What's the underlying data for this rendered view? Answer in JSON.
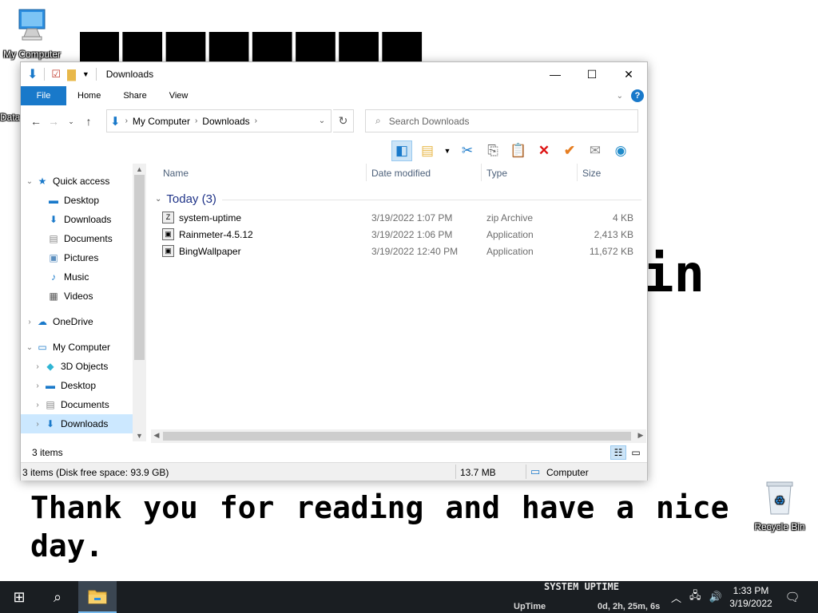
{
  "desktop": {
    "wallpaper_text_mid": "in",
    "wallpaper_text_bottom": "Thank you for reading and have a nice day.",
    "icons": {
      "my_computer": "My Computer",
      "data": "Data",
      "recycle_bin": "Recycle Bin"
    }
  },
  "window": {
    "title": "Downloads",
    "controls": {
      "minimize": "—",
      "maximize": "☐",
      "close": "✕"
    },
    "ribbon": {
      "tabs": [
        "File",
        "Home",
        "Share",
        "View"
      ],
      "help": "?"
    },
    "address": {
      "crumbs": [
        "My Computer",
        "Downloads"
      ],
      "search_placeholder": "Search Downloads"
    },
    "nav_pane": {
      "items": [
        {
          "label": "Quick access",
          "icon": "star-icon"
        },
        {
          "label": "Desktop",
          "icon": "desktop-icon"
        },
        {
          "label": "Downloads",
          "icon": "download-icon"
        },
        {
          "label": "Documents",
          "icon": "document-icon"
        },
        {
          "label": "Pictures",
          "icon": "picture-icon"
        },
        {
          "label": "Music",
          "icon": "music-icon"
        },
        {
          "label": "Videos",
          "icon": "video-icon"
        },
        {
          "label": "OneDrive",
          "icon": "cloud-icon"
        },
        {
          "label": "My Computer",
          "icon": "computer-icon"
        },
        {
          "label": "3D Objects",
          "icon": "cube-icon"
        },
        {
          "label": "Desktop",
          "icon": "desktop-icon"
        },
        {
          "label": "Documents",
          "icon": "document-icon"
        },
        {
          "label": "Downloads",
          "icon": "download-icon"
        }
      ]
    },
    "columns": {
      "name": "Name",
      "date": "Date modified",
      "type": "Type",
      "size": "Size"
    },
    "group": {
      "label": "Today (3)"
    },
    "files": [
      {
        "name": "system-uptime",
        "date": "3/19/2022 1:07 PM",
        "type": "zip Archive",
        "size": "4 KB",
        "icon": "zip-icon"
      },
      {
        "name": "Rainmeter-4.5.12",
        "date": "3/19/2022 1:06 PM",
        "type": "Application",
        "size": "2,413 KB",
        "icon": "installer-icon"
      },
      {
        "name": "BingWallpaper",
        "date": "3/19/2022 12:40 PM",
        "type": "Application",
        "size": "11,672 KB",
        "icon": "installer-icon"
      }
    ],
    "status": {
      "items_count": "3 items",
      "disk_info": "3 items (Disk free space: 93.9 GB)",
      "selection_size": "13.7 MB",
      "location": "Computer"
    }
  },
  "taskbar": {
    "uptime_title": "SYSTEM UPTIME",
    "uptime_label": "UpTime",
    "uptime_value": "0d, 2h, 25m, 6s",
    "time": "1:33 PM",
    "date": "3/19/2022"
  },
  "colors": {
    "accent": "#1979ca",
    "taskbar": "#1a1e22",
    "selection": "#cce8ff"
  }
}
